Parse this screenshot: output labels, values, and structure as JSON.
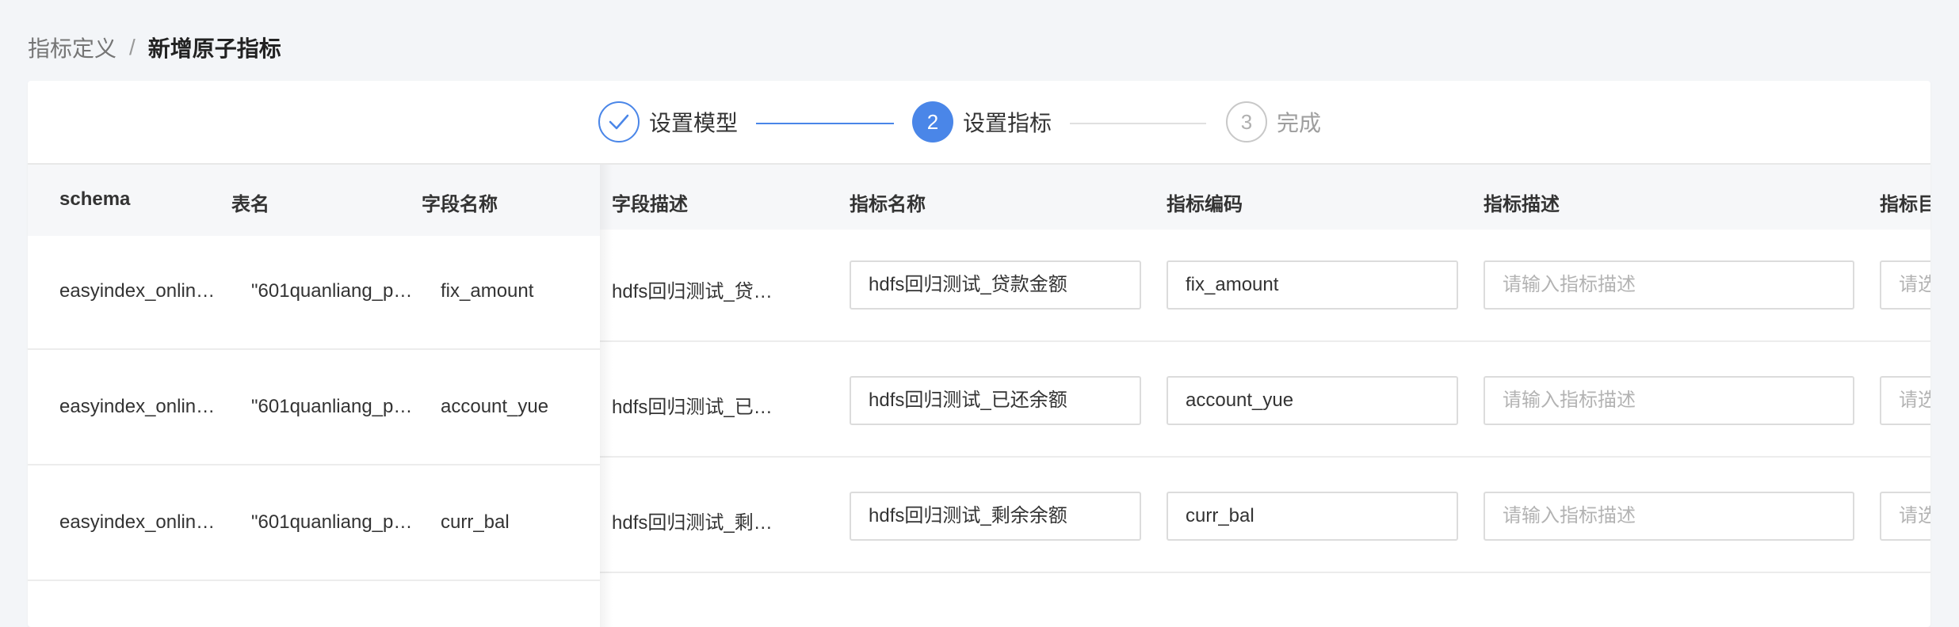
{
  "breadcrumb": {
    "parent": "指标定义",
    "separator": "/",
    "current": "新增原子指标"
  },
  "steps": [
    {
      "number": "",
      "label": "设置模型",
      "status": "done"
    },
    {
      "number": "2",
      "label": "设置指标",
      "status": "active"
    },
    {
      "number": "3",
      "label": "完成",
      "status": "wait"
    }
  ],
  "table": {
    "columns": [
      "schema",
      "表名",
      "字段名称",
      "字段描述",
      "指标名称",
      "指标编码",
      "指标描述",
      "指标目"
    ],
    "rows": [
      {
        "schema": "easyindex_onlin…",
        "table_name": "\"601quanliang_p…",
        "field_name": "fix_amount",
        "field_desc": "hdfs回归测试_贷…",
        "metric_name": "hdfs回归测试_贷款金额",
        "metric_code": "fix_amount",
        "metric_desc_placeholder": "请输入指标描述",
        "metric_dir_placeholder": "请选"
      },
      {
        "schema": "easyindex_onlin…",
        "table_name": "\"601quanliang_p…",
        "field_name": "account_yue",
        "field_desc": "hdfs回归测试_已…",
        "metric_name": "hdfs回归测试_已还余额",
        "metric_code": "account_yue",
        "metric_desc_placeholder": "请输入指标描述",
        "metric_dir_placeholder": "请选"
      },
      {
        "schema": "easyindex_onlin…",
        "table_name": "\"601quanliang_p…",
        "field_name": "curr_bal",
        "field_desc": "hdfs回归测试_剩…",
        "metric_name": "hdfs回归测试_剩余余额",
        "metric_code": "curr_bal",
        "metric_desc_placeholder": "请输入指标描述",
        "metric_dir_placeholder": "请选"
      }
    ]
  },
  "colors": {
    "primary": "#4a86e8",
    "page_bg": "#f3f5f8",
    "header_bg": "#f6f7f9"
  }
}
